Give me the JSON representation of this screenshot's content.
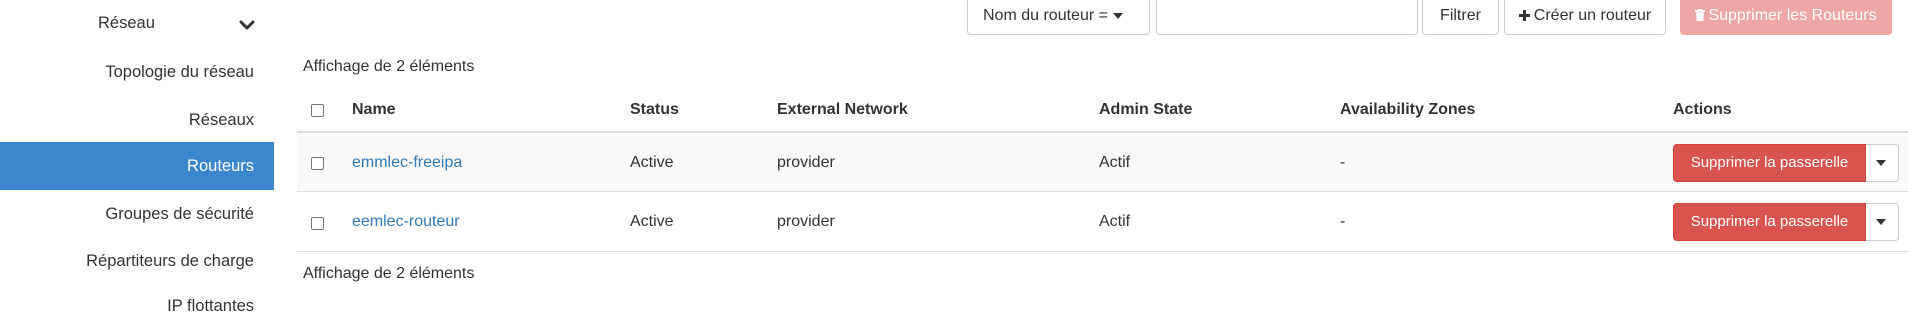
{
  "sidebar": {
    "section_label": "Réseau",
    "items": [
      {
        "label": "Topologie du réseau"
      },
      {
        "label": "Réseaux"
      },
      {
        "label": "Routeurs"
      },
      {
        "label": "Groupes de sécurité"
      },
      {
        "label": "Répartiteurs de charge"
      },
      {
        "label": "IP flottantes"
      }
    ],
    "active_item": "Routeurs",
    "active_color": "#3b86cc"
  },
  "toolbar": {
    "filter_field_label": "Nom du routeur =",
    "filter_input_value": "",
    "filter_button": "Filtrer",
    "create_button": "Créer un routeur",
    "delete_button": "Supprimer les Routeurs",
    "delete_button_color": "#eea7a5"
  },
  "table": {
    "count_top": "Affichage de 2 éléments",
    "count_bottom": "Affichage de 2 éléments",
    "columns": [
      "Name",
      "Status",
      "External Network",
      "Admin State",
      "Availability Zones",
      "Actions"
    ],
    "rows": [
      {
        "name": "emmlec-freeipa",
        "status": "Active",
        "external_network": "provider",
        "admin_state": "Actif",
        "availability_zones": "-",
        "action": "Supprimer la passerelle"
      },
      {
        "name": "eemlec-routeur",
        "status": "Active",
        "external_network": "provider",
        "admin_state": "Actif",
        "availability_zones": "-",
        "action": "Supprimer la passerelle"
      }
    ],
    "link_color": "#337ab7",
    "action_color": "#d9534f"
  }
}
